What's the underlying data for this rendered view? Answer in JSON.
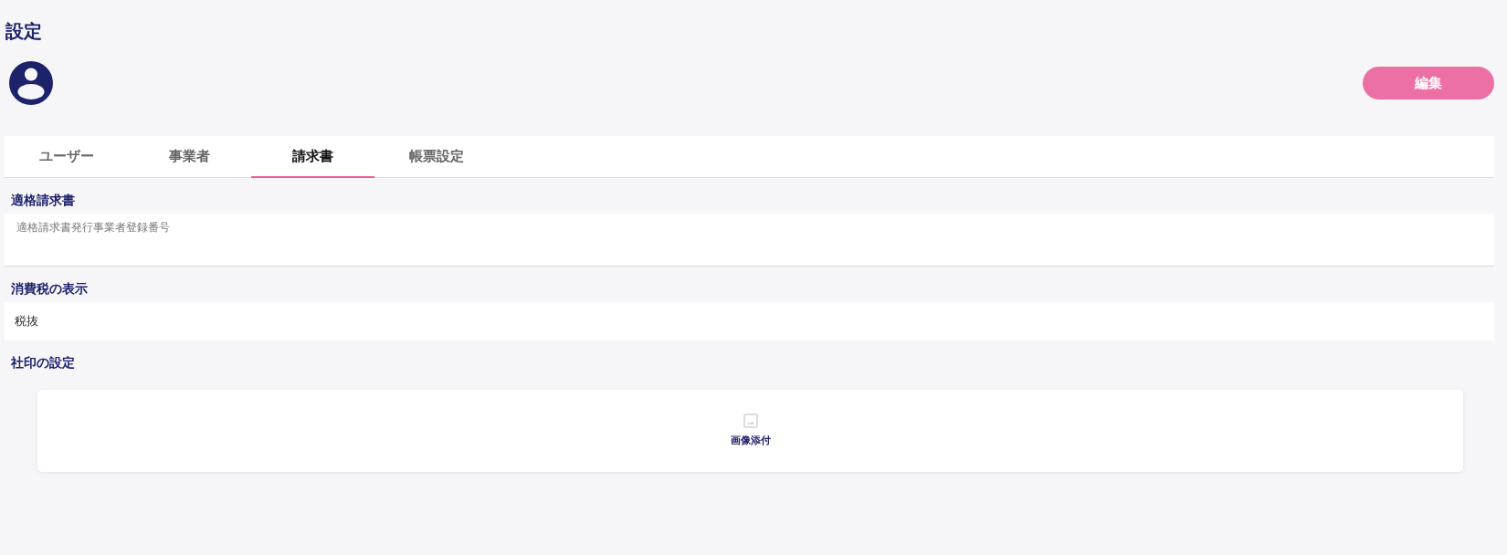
{
  "page_title": "設定",
  "edit_button": "編集",
  "tabs": [
    {
      "label": "ユーザー",
      "selected": false
    },
    {
      "label": "事業者",
      "selected": false
    },
    {
      "label": "請求書",
      "selected": true
    },
    {
      "label": "帳票設定",
      "selected": false
    }
  ],
  "sections": [
    {
      "kind": "field",
      "heading": "適格請求書",
      "placeholder": "適格請求書発行事業者登録番号"
    },
    {
      "kind": "value",
      "heading": "消費税の表示",
      "value": "税抜"
    },
    {
      "kind": "upload",
      "heading": "社印の設定",
      "label": "画像添付"
    }
  ]
}
